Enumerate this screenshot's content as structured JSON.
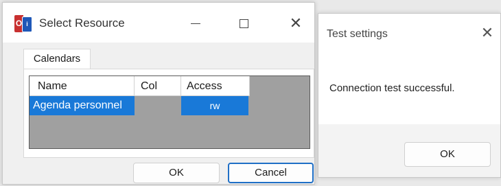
{
  "select_resource": {
    "title": "Select Resource",
    "icon_text_left": "O",
    "icon_text_right": "i",
    "tab_label": "Calendars",
    "table": {
      "headers": [
        "Name",
        "Col",
        "Access"
      ],
      "rows": [
        {
          "name": "Agenda personnel",
          "col": "",
          "access": "rw"
        }
      ]
    },
    "ok_label": "OK",
    "cancel_label": "Cancel"
  },
  "test_settings": {
    "title": "Test settings",
    "message": "Connection test successful.",
    "ok_label": "OK"
  },
  "colors": {
    "selection": "#1979d8",
    "focus_border": "#1f6fc6"
  }
}
